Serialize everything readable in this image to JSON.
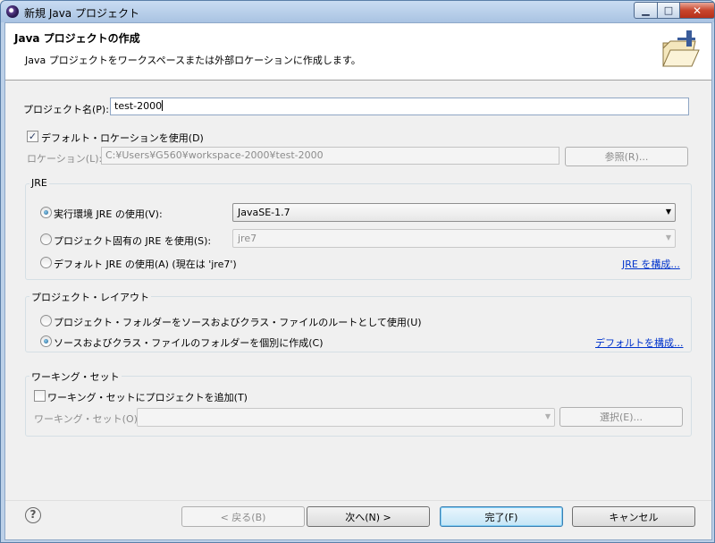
{
  "window": {
    "title": "新規 Java プロジェクト",
    "minimize_glyph": "▁",
    "maximize_glyph": "□",
    "close_glyph": "✕"
  },
  "header": {
    "title": "Java プロジェクトの作成",
    "description": "Java プロジェクトをワークスペースまたは外部ロケーションに作成します。"
  },
  "project_name": {
    "label": "プロジェクト名(P):",
    "value": "test-2000"
  },
  "location": {
    "use_default_label": "デフォルト・ロケーションを使用(D)",
    "use_default_checked": true,
    "check_glyph": "✓",
    "label": "ロケーション(L):",
    "value": "C:¥Users¥G560¥workspace-2000¥test-2000",
    "browse_label": "参照(R)..."
  },
  "jre": {
    "group_title": "JRE",
    "option_exec_env": "実行環境 JRE の使用(V):",
    "exec_env_value": "JavaSE-1.7",
    "option_project_specific": "プロジェクト固有の JRE を使用(S):",
    "project_specific_value": "jre7",
    "option_default": "デフォルト JRE の使用(A) (現在は 'jre7')",
    "configure_link": "JRE を構成...",
    "selected": "exec_env"
  },
  "layout": {
    "group_title": "プロジェクト・レイアウト",
    "option_root": "プロジェクト・フォルダーをソースおよびクラス・ファイルのルートとして使用(U)",
    "option_separate": "ソースおよびクラス・ファイルのフォルダーを個別に作成(C)",
    "configure_default_link": "デフォルトを構成...",
    "selected": "separate"
  },
  "working_sets": {
    "group_title": "ワーキング・セット",
    "add_label": "ワーキング・セットにプロジェクトを追加(T)",
    "add_checked": false,
    "sets_label": "ワーキング・セット(O):",
    "sets_value": "",
    "select_label": "選択(E)..."
  },
  "footer": {
    "help_glyph": "?",
    "back_label": "< 戻る(B)",
    "next_label": "次へ(N) >",
    "finish_label": "完了(F)",
    "cancel_label": "キャンセル"
  },
  "icons": {
    "dropdown": "▼"
  }
}
